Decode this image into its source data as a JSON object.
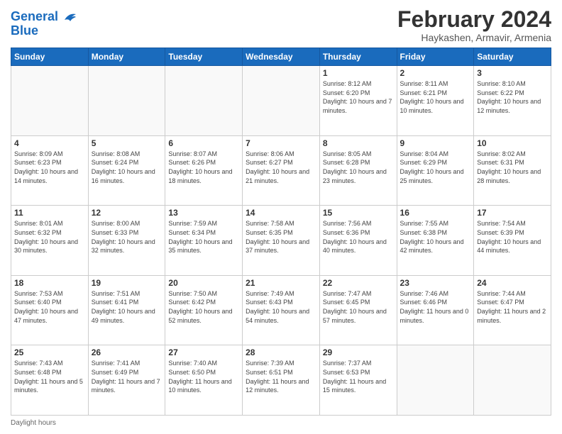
{
  "header": {
    "logo_line1": "General",
    "logo_line2": "Blue",
    "main_title": "February 2024",
    "subtitle": "Haykashen, Armavir, Armenia"
  },
  "calendar": {
    "days_of_week": [
      "Sunday",
      "Monday",
      "Tuesday",
      "Wednesday",
      "Thursday",
      "Friday",
      "Saturday"
    ],
    "weeks": [
      [
        {
          "day": "",
          "info": ""
        },
        {
          "day": "",
          "info": ""
        },
        {
          "day": "",
          "info": ""
        },
        {
          "day": "",
          "info": ""
        },
        {
          "day": "1",
          "info": "Sunrise: 8:12 AM\nSunset: 6:20 PM\nDaylight: 10 hours and 7 minutes."
        },
        {
          "day": "2",
          "info": "Sunrise: 8:11 AM\nSunset: 6:21 PM\nDaylight: 10 hours and 10 minutes."
        },
        {
          "day": "3",
          "info": "Sunrise: 8:10 AM\nSunset: 6:22 PM\nDaylight: 10 hours and 12 minutes."
        }
      ],
      [
        {
          "day": "4",
          "info": "Sunrise: 8:09 AM\nSunset: 6:23 PM\nDaylight: 10 hours and 14 minutes."
        },
        {
          "day": "5",
          "info": "Sunrise: 8:08 AM\nSunset: 6:24 PM\nDaylight: 10 hours and 16 minutes."
        },
        {
          "day": "6",
          "info": "Sunrise: 8:07 AM\nSunset: 6:26 PM\nDaylight: 10 hours and 18 minutes."
        },
        {
          "day": "7",
          "info": "Sunrise: 8:06 AM\nSunset: 6:27 PM\nDaylight: 10 hours and 21 minutes."
        },
        {
          "day": "8",
          "info": "Sunrise: 8:05 AM\nSunset: 6:28 PM\nDaylight: 10 hours and 23 minutes."
        },
        {
          "day": "9",
          "info": "Sunrise: 8:04 AM\nSunset: 6:29 PM\nDaylight: 10 hours and 25 minutes."
        },
        {
          "day": "10",
          "info": "Sunrise: 8:02 AM\nSunset: 6:31 PM\nDaylight: 10 hours and 28 minutes."
        }
      ],
      [
        {
          "day": "11",
          "info": "Sunrise: 8:01 AM\nSunset: 6:32 PM\nDaylight: 10 hours and 30 minutes."
        },
        {
          "day": "12",
          "info": "Sunrise: 8:00 AM\nSunset: 6:33 PM\nDaylight: 10 hours and 32 minutes."
        },
        {
          "day": "13",
          "info": "Sunrise: 7:59 AM\nSunset: 6:34 PM\nDaylight: 10 hours and 35 minutes."
        },
        {
          "day": "14",
          "info": "Sunrise: 7:58 AM\nSunset: 6:35 PM\nDaylight: 10 hours and 37 minutes."
        },
        {
          "day": "15",
          "info": "Sunrise: 7:56 AM\nSunset: 6:36 PM\nDaylight: 10 hours and 40 minutes."
        },
        {
          "day": "16",
          "info": "Sunrise: 7:55 AM\nSunset: 6:38 PM\nDaylight: 10 hours and 42 minutes."
        },
        {
          "day": "17",
          "info": "Sunrise: 7:54 AM\nSunset: 6:39 PM\nDaylight: 10 hours and 44 minutes."
        }
      ],
      [
        {
          "day": "18",
          "info": "Sunrise: 7:53 AM\nSunset: 6:40 PM\nDaylight: 10 hours and 47 minutes."
        },
        {
          "day": "19",
          "info": "Sunrise: 7:51 AM\nSunset: 6:41 PM\nDaylight: 10 hours and 49 minutes."
        },
        {
          "day": "20",
          "info": "Sunrise: 7:50 AM\nSunset: 6:42 PM\nDaylight: 10 hours and 52 minutes."
        },
        {
          "day": "21",
          "info": "Sunrise: 7:49 AM\nSunset: 6:43 PM\nDaylight: 10 hours and 54 minutes."
        },
        {
          "day": "22",
          "info": "Sunrise: 7:47 AM\nSunset: 6:45 PM\nDaylight: 10 hours and 57 minutes."
        },
        {
          "day": "23",
          "info": "Sunrise: 7:46 AM\nSunset: 6:46 PM\nDaylight: 11 hours and 0 minutes."
        },
        {
          "day": "24",
          "info": "Sunrise: 7:44 AM\nSunset: 6:47 PM\nDaylight: 11 hours and 2 minutes."
        }
      ],
      [
        {
          "day": "25",
          "info": "Sunrise: 7:43 AM\nSunset: 6:48 PM\nDaylight: 11 hours and 5 minutes."
        },
        {
          "day": "26",
          "info": "Sunrise: 7:41 AM\nSunset: 6:49 PM\nDaylight: 11 hours and 7 minutes."
        },
        {
          "day": "27",
          "info": "Sunrise: 7:40 AM\nSunset: 6:50 PM\nDaylight: 11 hours and 10 minutes."
        },
        {
          "day": "28",
          "info": "Sunrise: 7:39 AM\nSunset: 6:51 PM\nDaylight: 11 hours and 12 minutes."
        },
        {
          "day": "29",
          "info": "Sunrise: 7:37 AM\nSunset: 6:53 PM\nDaylight: 11 hours and 15 minutes."
        },
        {
          "day": "",
          "info": ""
        },
        {
          "day": "",
          "info": ""
        }
      ]
    ]
  },
  "footer": {
    "daylight_label": "Daylight hours"
  }
}
